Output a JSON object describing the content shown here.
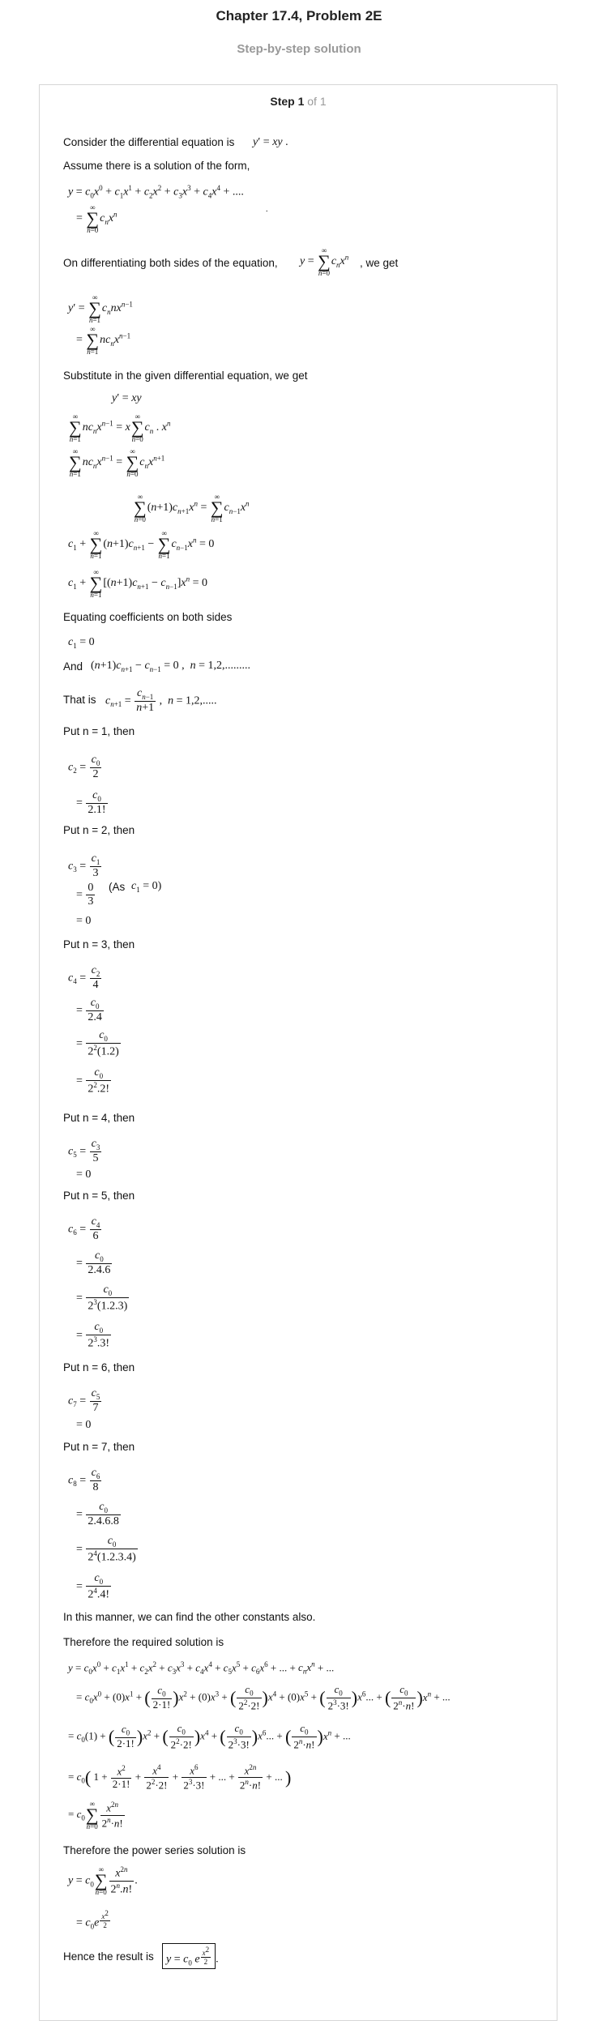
{
  "header": {
    "title": "Chapter 17.4, Problem 2E",
    "subtitle": "Step-by-step solution"
  },
  "step": {
    "label": "Step 1",
    "count": "of 1"
  },
  "text": {
    "t1": "Consider the differential equation is",
    "t2": "Assume there is a solution of the form,",
    "t3": "On differentiating both sides of the equation,",
    "t3b": ", we get",
    "t4": "Substitute in the given differential equation, we get",
    "t5": "Equating coefficients on both sides",
    "t6": "And",
    "t7": "That is",
    "p1": "Put n = 1, then",
    "p2": "Put n = 2, then",
    "as": "(As",
    "p3": "Put n = 3, then",
    "p4": "Put n = 4, then",
    "p5": "Put n = 5, then",
    "p6": "Put n = 6, then",
    "p7": "Put n = 7, then",
    "t8": "In this manner, we can find the other constants also.",
    "t9": "Therefore the required solution is",
    "t10": "Therefore the power series solution is",
    "t11": "Hence the result is"
  }
}
